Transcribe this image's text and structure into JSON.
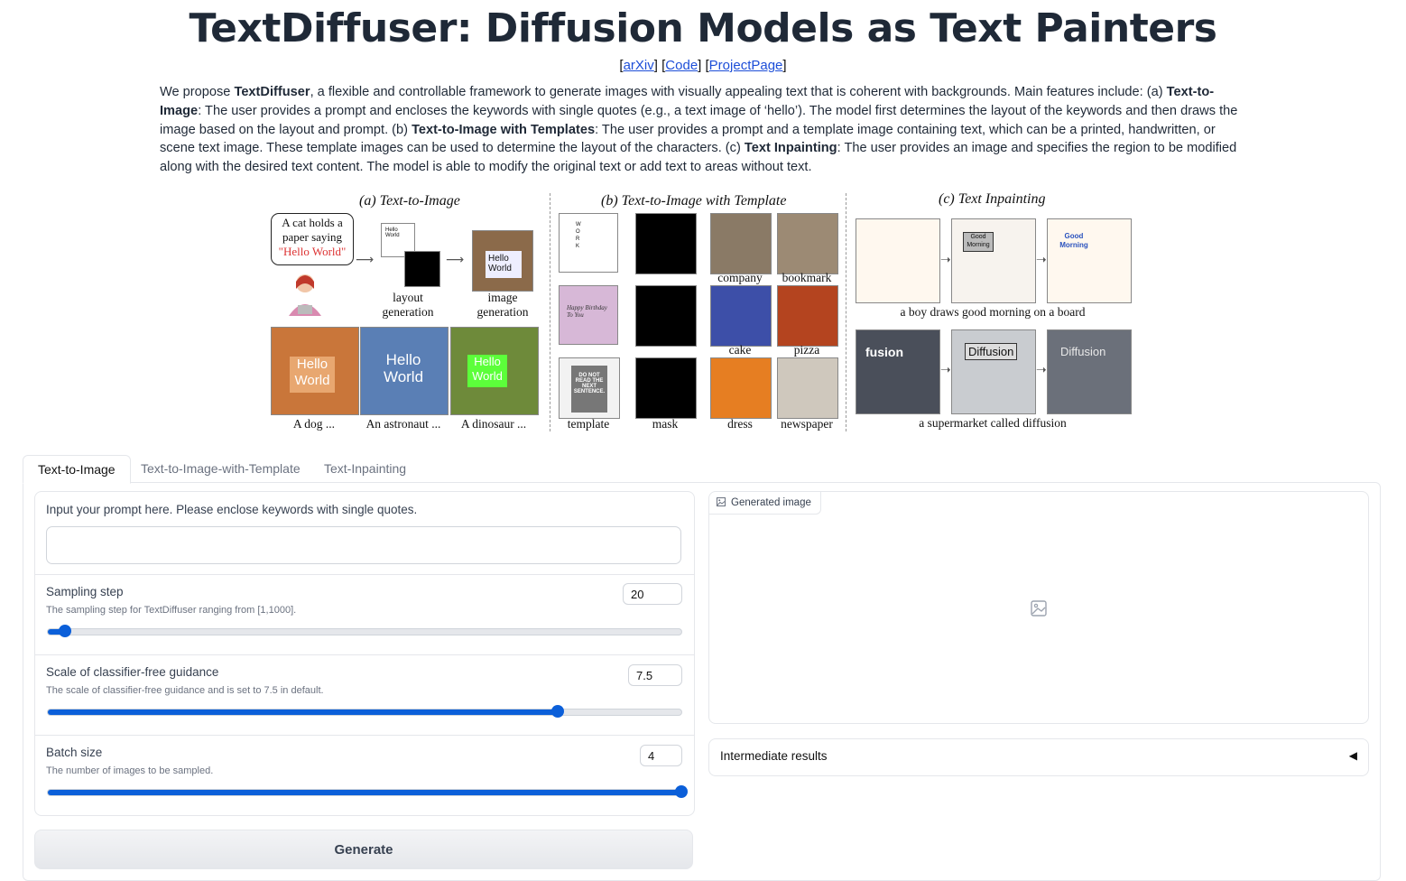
{
  "header": {
    "title": "TextDiffuser: Diffusion Models as Text Painters",
    "links": [
      {
        "label": "arXiv"
      },
      {
        "label": "Code"
      },
      {
        "label": "ProjectPage"
      }
    ]
  },
  "description": {
    "p1": "We propose ",
    "b1": "TextDiffuser",
    "p2": ", a flexible and controllable framework to generate images with visually appealing text that is coherent with backgrounds. Main features include: (a) ",
    "b2": "Text-to-Image",
    "p3": ": The user provides a prompt and encloses the keywords with single quotes (e.g., a text image of ‘hello’). The model first determines the layout of the keywords and then draws the image based on the layout and prompt. (b) ",
    "b3": "Text-to-Image with Templates",
    "p4": ": The user provides a prompt and a template image containing text, which can be a printed, handwritten, or scene text image. These template images can be used to determine the layout of the characters. (c) ",
    "b4": "Text Inpainting",
    "p5": ": The user provides an image and specifies the region to be modified along with the desired text content. The model is able to modify the original text or add text to areas without text."
  },
  "figure": {
    "section_a_title": "(a) Text-to-Image",
    "section_b_title": "(b) Text-to-Image with Template",
    "section_c_title": "(c) Text Inpainting",
    "bubble_line1": "A cat holds a",
    "bubble_line2": "paper saying",
    "bubble_line3": "\"Hello World\"",
    "layout_caption": "layout generation",
    "image_caption": "image generation",
    "hello_text": "Hello",
    "world_text": "World",
    "a_captions": [
      "A dog ...",
      "An astronaut ...",
      "A dinosaur ..."
    ],
    "b_captions_row1": [
      "company",
      "bookmark"
    ],
    "b_captions_row2": [
      "cake",
      "pizza"
    ],
    "b_captions_row3": [
      "template",
      "mask",
      "dress",
      "newspaper"
    ],
    "template_words": [
      "WORK",
      "Happy Birthday To You",
      "DO NOT READ THE NEXT SENTENCE."
    ],
    "c_caption_1": "a boy draws good morning on a board",
    "c_caption_2": "a supermarket called diffusion",
    "c_words": [
      "Good Morning",
      "fusion",
      "Diffusion"
    ],
    "colors": {
      "dog_bg": "#c9763a",
      "astronaut_bg": "#5a7fb5",
      "dino_bg": "#6e8a3a",
      "bday_bg": "#d7b8d7",
      "pizza_bg": "#b4441f",
      "dress_bg": "#e67e22"
    }
  },
  "tabs": [
    {
      "label": "Text-to-Image",
      "active": true
    },
    {
      "label": "Text-to-Image-with-Template",
      "active": false
    },
    {
      "label": "Text-Inpainting",
      "active": false
    }
  ],
  "form": {
    "prompt_label": "Input your prompt here. Please enclose keywords with single quotes.",
    "prompt_value": "",
    "sampling": {
      "label": "Sampling step",
      "info": "The sampling step for TextDiffuser ranging from [1,1000].",
      "value": "20",
      "fraction": 0.027
    },
    "guidance": {
      "label": "Scale of classifier-free guidance",
      "info": "The scale of classifier-free guidance and is set to 7.5 in default.",
      "value": "7.5",
      "fraction": 0.805
    },
    "batch": {
      "label": "Batch size",
      "info": "The number of images to be sampled.",
      "value": "4",
      "fraction": 1.0
    },
    "generate_label": "Generate"
  },
  "output": {
    "image_label": "Generated image",
    "accordion_label": "Intermediate results",
    "accordion_caret": "◀"
  },
  "accent_color": "#0b5fd9"
}
